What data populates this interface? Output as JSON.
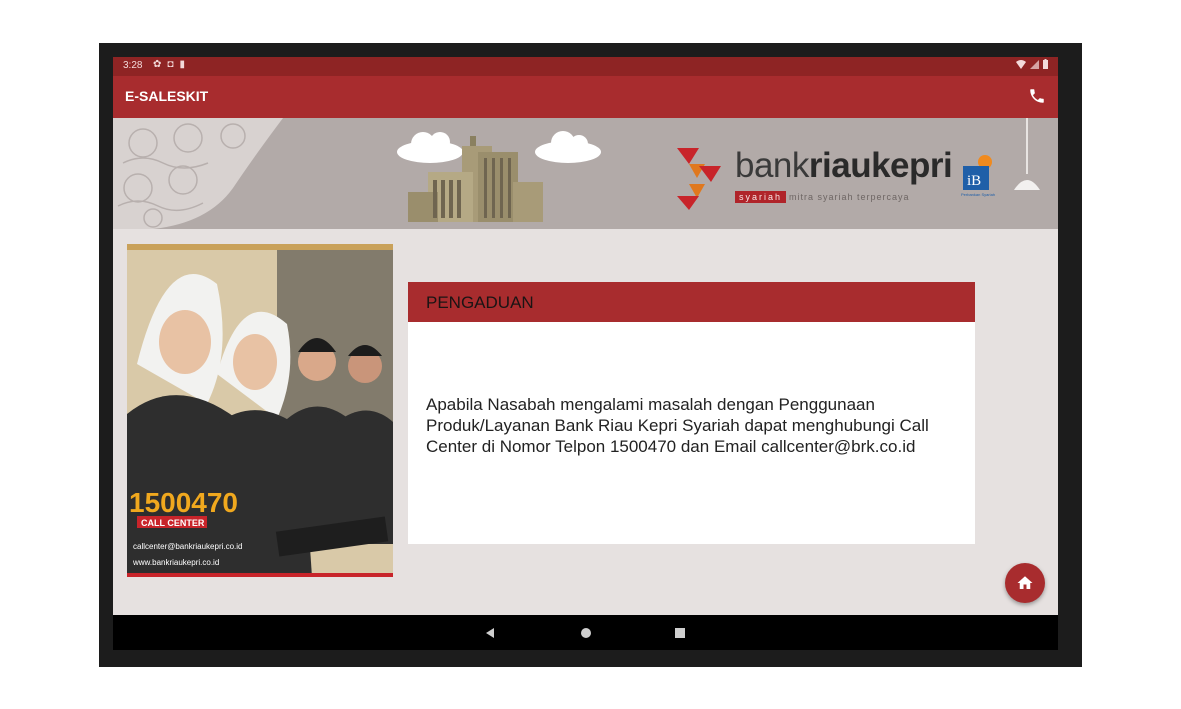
{
  "status_bar": {
    "time": "3:28",
    "icons": [
      "settings-icon",
      "notification-icon",
      "sd-card-icon"
    ],
    "right_icons": [
      "wifi-icon",
      "signal-icon",
      "battery-icon"
    ]
  },
  "app_bar": {
    "title": "E-SALESKIT",
    "action_icon": "phone-icon"
  },
  "banner": {
    "bank_name_light": "bank",
    "bank_name_bold": "riaukepri",
    "tag_syariah": "syariah",
    "tag_motto": "mitra syariah terpercaya",
    "ib_label": "iB",
    "ib_sub": "Perbankan Syariah"
  },
  "photo": {
    "callcenter_number": "1500470",
    "callcenter_label": "CALL CENTER",
    "email": "callcenter@bankriaukepri.co.id",
    "website": "www.bankriaukepri.co.id"
  },
  "card": {
    "title": "PENGADUAN",
    "body": "Apabila Nasabah mengalami masalah dengan Penggunaan Produk/Layanan Bank Riau Kepri Syariah dapat menghubungi Call Center di Nomor Telpon 1500470 dan Email callcenter@brk.co.id"
  },
  "fab": {
    "icon": "home-icon"
  },
  "nav_bar": {
    "buttons": [
      "back-icon",
      "home-icon",
      "recents-icon"
    ]
  },
  "colors": {
    "primary": "#a82c2e",
    "status": "#8e2424",
    "background": "#e6e1e0",
    "banner": "#b2aaa8"
  }
}
